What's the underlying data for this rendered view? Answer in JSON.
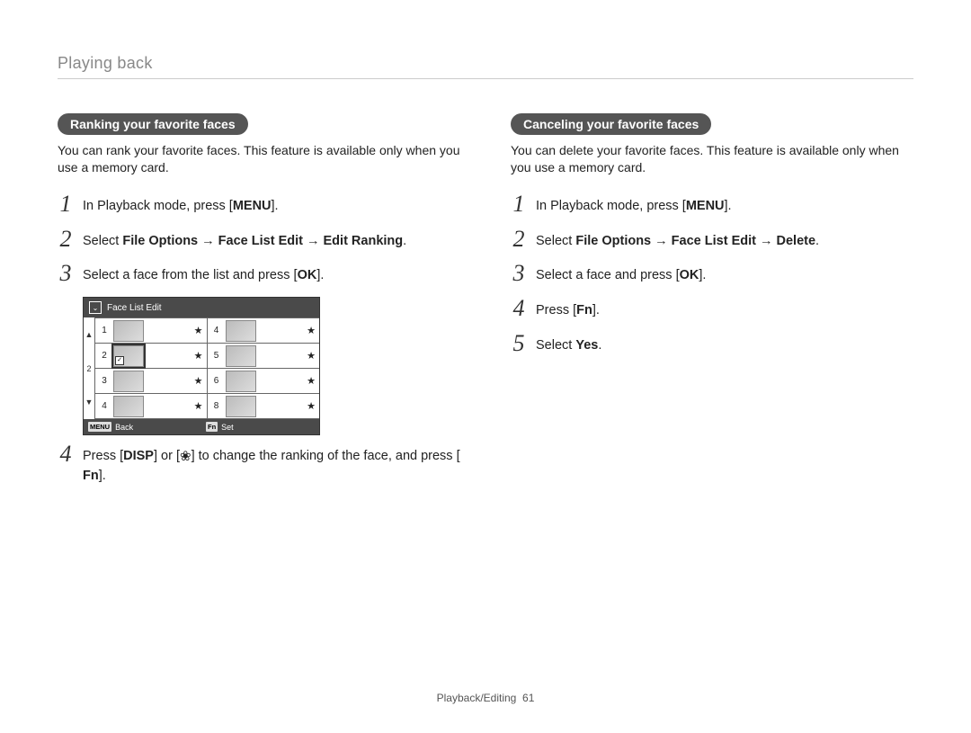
{
  "section_title": "Playing back",
  "left": {
    "pill": "Ranking your favorite faces",
    "intro": "You can rank your favorite faces. This feature is available only when you use a memory card.",
    "steps": {
      "s1_pre": "In Playback mode, press [",
      "s1_key": "MENU",
      "s1_post": "].",
      "s2_pre": "Select ",
      "s2_bold": "File Options → Face List Edit → Edit Ranking",
      "s2_post": ".",
      "s3_pre": "Select a face from the list and press [",
      "s3_key": "OK",
      "s3_post": "].",
      "s4_a": "Press [",
      "s4_key1": "DISP",
      "s4_b": "] or [",
      "s4_icon_name": "macro-flower-icon",
      "s4_c": "] to change the ranking of the face, and press [",
      "s4_key2": "Fn",
      "s4_d": "]."
    },
    "lcd": {
      "title": "Face List Edit",
      "footer_back_badge": "MENU",
      "footer_back_label": "Back",
      "footer_set_badge": "Fn",
      "footer_set_label": "Set",
      "scroll_top_glyph": "▲",
      "scroll_num": "2",
      "scroll_bot_glyph": "▼",
      "cells": [
        {
          "n": "1",
          "star": "★",
          "sel": false,
          "check": false
        },
        {
          "n": "4",
          "star": "★",
          "sel": false,
          "check": false
        },
        {
          "n": "2",
          "star": "★",
          "sel": true,
          "check": true
        },
        {
          "n": "5",
          "star": "★",
          "sel": false,
          "check": false
        },
        {
          "n": "3",
          "star": "★",
          "sel": false,
          "check": false
        },
        {
          "n": "6",
          "star": "★",
          "sel": false,
          "check": false
        },
        {
          "n": "4",
          "star": "★",
          "sel": false,
          "check": false
        },
        {
          "n": "8",
          "star": "★",
          "sel": false,
          "check": false
        }
      ]
    }
  },
  "right": {
    "pill": "Canceling your favorite faces",
    "intro": "You can delete your favorite faces. This feature is available only when you use a memory card.",
    "steps": {
      "s1_pre": "In Playback mode, press [",
      "s1_key": "MENU",
      "s1_post": "].",
      "s2_pre": "Select ",
      "s2_bold": "File Options → Face List Edit → Delete",
      "s2_post": ".",
      "s3_pre": "Select a face and press [",
      "s3_key": "OK",
      "s3_post": "].",
      "s4_pre": "Press [",
      "s4_key": "Fn",
      "s4_post": "].",
      "s5_pre": "Select ",
      "s5_bold": "Yes",
      "s5_post": "."
    }
  },
  "footer": {
    "label": "Playback/Editing",
    "page": "61"
  }
}
